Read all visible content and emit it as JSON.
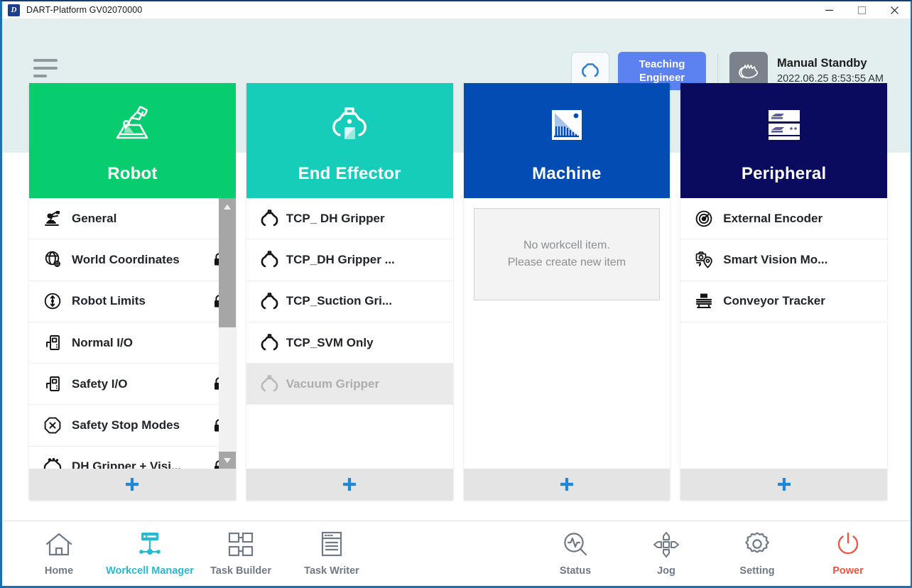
{
  "window": {
    "logo_letter": "D",
    "title": "DART-Platform GV02070000",
    "minimize_label": "Minimize",
    "maximize_label": "Maximize",
    "close_label": "Close"
  },
  "header": {
    "menu_label": "Main Menu",
    "robot_status_icon": "gripper-status-icon",
    "teaching_line1": "Teaching",
    "teaching_line2": "Engineer",
    "mode_icon": "manual-hand-icon",
    "mode_title": "Manual Standby",
    "mode_datetime": "2022.06.25 8:53:55 AM",
    "accent_teaching": "#5b82f0",
    "background": "#e3efee"
  },
  "columns": [
    {
      "key": "robot",
      "title": "Robot",
      "color": "#07cd6e",
      "icon": "robot-arm-icon",
      "add_label": "+",
      "scrollable": true,
      "items": [
        {
          "label": "General",
          "icon": "robot-arm-small-icon",
          "locked": false,
          "disabled": false
        },
        {
          "label": "World Coordinates",
          "icon": "world-coordinates-icon",
          "locked": true,
          "disabled": false
        },
        {
          "label": "Robot Limits",
          "icon": "robot-limits-icon",
          "locked": true,
          "disabled": false
        },
        {
          "label": "Normal I/O",
          "icon": "normal-io-icon",
          "locked": false,
          "disabled": false
        },
        {
          "label": "Safety I/O",
          "icon": "safety-io-icon",
          "locked": true,
          "disabled": false
        },
        {
          "label": "Safety Stop Modes",
          "icon": "safety-stop-icon",
          "locked": true,
          "disabled": false
        },
        {
          "label": "DH Gripper + Visi...",
          "icon": "dh-gripper-vision-icon",
          "locked": true,
          "disabled": false
        }
      ]
    },
    {
      "key": "end_effector",
      "title": "End Effector",
      "color": "#15cdb9",
      "icon": "end-effector-icon",
      "add_label": "+",
      "scrollable": false,
      "items": [
        {
          "label": "TCP_ DH Gripper",
          "icon": "tcp-icon",
          "locked": false,
          "disabled": false
        },
        {
          "label": "TCP_DH Gripper ...",
          "icon": "tcp-icon",
          "locked": false,
          "disabled": false
        },
        {
          "label": "TCP_Suction Gri...",
          "icon": "tcp-icon",
          "locked": false,
          "disabled": false
        },
        {
          "label": "TCP_SVM Only",
          "icon": "tcp-icon",
          "locked": false,
          "disabled": false
        },
        {
          "label": "Vacuum Gripper",
          "icon": "tcp-icon",
          "locked": false,
          "disabled": true
        }
      ]
    },
    {
      "key": "machine",
      "title": "Machine",
      "color": "#034cb4",
      "icon": "machine-icon",
      "add_label": "+",
      "scrollable": false,
      "items": [],
      "empty_line1": "No workcell item.",
      "empty_line2": "Please create new item"
    },
    {
      "key": "peripheral",
      "title": "Peripheral",
      "color": "#0a0a5e",
      "icon": "peripheral-icon",
      "add_label": "+",
      "scrollable": false,
      "items": [
        {
          "label": "External Encoder",
          "icon": "external-encoder-icon",
          "locked": false,
          "disabled": false
        },
        {
          "label": "Smart Vision Mo...",
          "icon": "smart-vision-module-icon",
          "locked": false,
          "disabled": false
        },
        {
          "label": "Conveyor Tracker",
          "icon": "conveyor-tracker-icon",
          "locked": false,
          "disabled": false
        }
      ]
    }
  ],
  "bottom_nav": {
    "left": [
      {
        "label": "Home",
        "icon": "home-icon",
        "active": false
      },
      {
        "label": "Workcell Manager",
        "icon": "workcell-manager-icon",
        "active": true
      },
      {
        "label": "Task Builder",
        "icon": "task-builder-icon",
        "active": false
      },
      {
        "label": "Task Writer",
        "icon": "task-writer-icon",
        "active": false
      }
    ],
    "right": [
      {
        "label": "Status",
        "icon": "status-icon",
        "active": false
      },
      {
        "label": "Jog",
        "icon": "jog-icon",
        "active": false
      },
      {
        "label": "Setting",
        "icon": "setting-icon",
        "active": false
      },
      {
        "label": "Power",
        "icon": "power-icon",
        "active": false,
        "danger": true
      }
    ],
    "active_color": "#26b9d4",
    "danger_color": "#f0533e",
    "idle_color": "#6f7a86"
  }
}
